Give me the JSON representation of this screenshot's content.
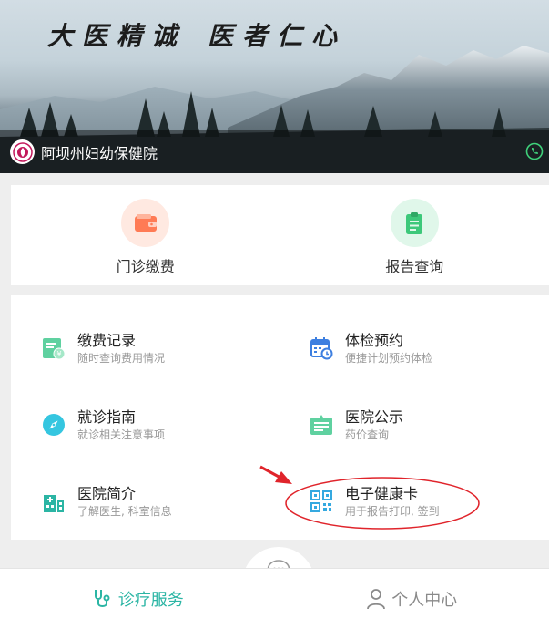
{
  "banner": {
    "motto_left": "大医精诚",
    "motto_right": "医者仁心",
    "hospital_name": "阿坝州妇幼保健院"
  },
  "quick": [
    {
      "label": "门诊缴费",
      "icon": "wallet-icon",
      "color": "#ff7b55",
      "bg": "#ffe9e1"
    },
    {
      "label": "报告查询",
      "icon": "clipboard-icon",
      "color": "#3dc87a",
      "bg": "#e0f7ea"
    }
  ],
  "grid": [
    {
      "title": "缴费记录",
      "sub": "随时查询费用情况",
      "icon": "bill-icon",
      "color": "#5fd1a0"
    },
    {
      "title": "体检预约",
      "sub": "便捷计划预约体检",
      "icon": "calendar-icon",
      "color": "#3d7fe0"
    },
    {
      "title": "就诊指南",
      "sub": "就诊相关注意事项",
      "icon": "compass-icon",
      "color": "#35c6e0"
    },
    {
      "title": "医院公示",
      "sub": "药价查询",
      "icon": "notice-icon",
      "color": "#5fd1a0"
    },
    {
      "title": "医院简介",
      "sub": "了解医生, 科室信息",
      "icon": "hospital-icon",
      "color": "#2bb5a4"
    },
    {
      "title": "电子健康卡",
      "sub": "用于报告打印, 签到",
      "icon": "qrcode-icon",
      "color": "#35a9e0"
    }
  ],
  "tabbar": {
    "services": "诊疗服务",
    "personal": "个人中心"
  },
  "colors": {
    "accent": "#2bb5a4",
    "annotation": "#e0242b"
  }
}
